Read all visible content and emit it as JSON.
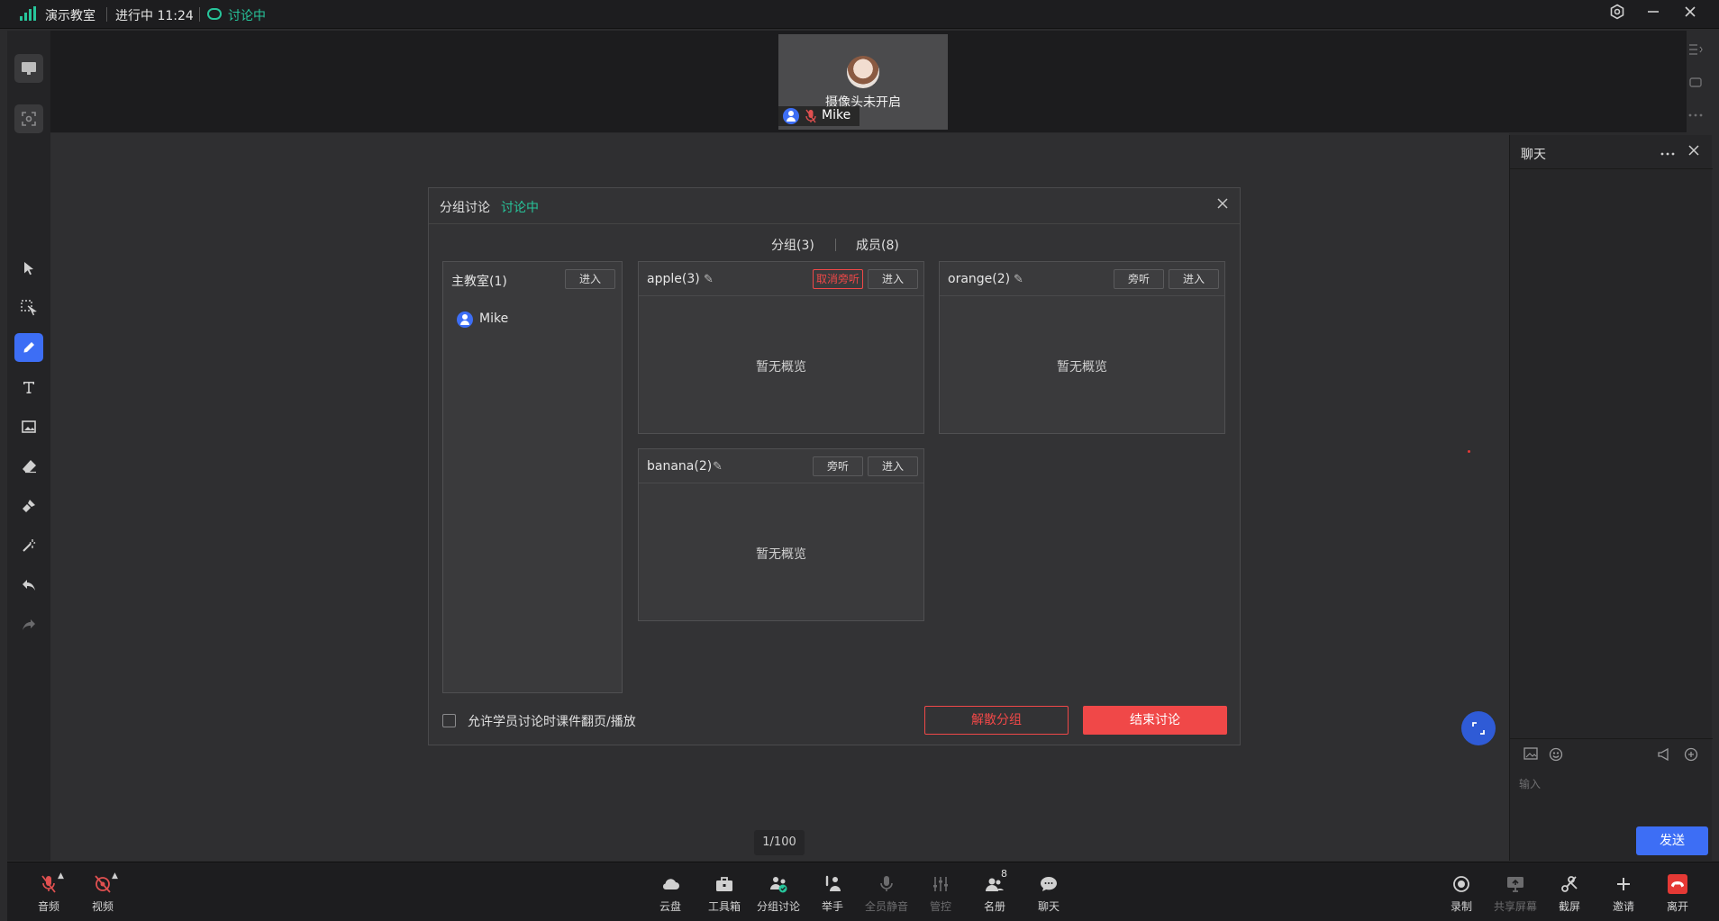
{
  "topbar": {
    "classroom_name": "演示教室",
    "status_time": "进行中 11:24",
    "discussion_status": "讨论中",
    "accent_green": "#27c59b"
  },
  "video": {
    "camera_off_text": "摄像头未开启",
    "participant_name": "Mike"
  },
  "left_tools": [
    "pointer-icon",
    "select-icon",
    "pen-icon",
    "text-icon",
    "image-icon",
    "eraser-icon",
    "brush-icon",
    "laser-icon",
    "undo-icon",
    "redo-icon"
  ],
  "dialog": {
    "title": "分组讨论",
    "status": "讨论中",
    "tabs": [
      "分组(3)",
      "成员(8)"
    ],
    "main_room": {
      "title": "主教室(1)",
      "enter_label": "进入",
      "member": "Mike"
    },
    "groups": [
      {
        "name": "apple(3)",
        "listen_label": "取消旁听",
        "enter_label": "进入",
        "preview": "暂无概览"
      },
      {
        "name": "orange(2)",
        "listen_label": "旁听",
        "enter_label": "进入",
        "preview": "暂无概览"
      },
      {
        "name": "banana(2)",
        "listen_label": "旁听",
        "enter_label": "进入",
        "preview": "暂无概览"
      }
    ],
    "allow_label": "允许学员讨论时课件翻页/播放",
    "disband_label": "解散分组",
    "end_label": "结束讨论",
    "danger_color": "#f04848"
  },
  "page_indicator": "1/100",
  "chat": {
    "title": "聊天",
    "input_placeholder": "输入",
    "send_label": "发送"
  },
  "bottombar": {
    "left": [
      {
        "label": "音频",
        "icon": "mic-muted-icon"
      },
      {
        "label": "视频",
        "icon": "camera-off-icon"
      }
    ],
    "center": [
      {
        "label": "云盘",
        "icon": "cloud-icon"
      },
      {
        "label": "工具箱",
        "icon": "toolbox-icon"
      },
      {
        "label": "分组讨论",
        "icon": "breakout-icon"
      },
      {
        "label": "举手",
        "icon": "raise-hand-icon"
      },
      {
        "label": "全员静音",
        "icon": "mute-all-icon"
      },
      {
        "label": "管控",
        "icon": "control-icon"
      },
      {
        "label": "名册",
        "icon": "roster-icon",
        "badge": "8"
      },
      {
        "label": "聊天",
        "icon": "chat-icon"
      }
    ],
    "right": [
      {
        "label": "录制",
        "icon": "record-icon"
      },
      {
        "label": "共享屏幕",
        "icon": "share-screen-icon"
      },
      {
        "label": "截屏",
        "icon": "screenshot-icon"
      },
      {
        "label": "邀请",
        "icon": "invite-icon"
      },
      {
        "label": "离开",
        "icon": "leave-icon"
      }
    ]
  }
}
